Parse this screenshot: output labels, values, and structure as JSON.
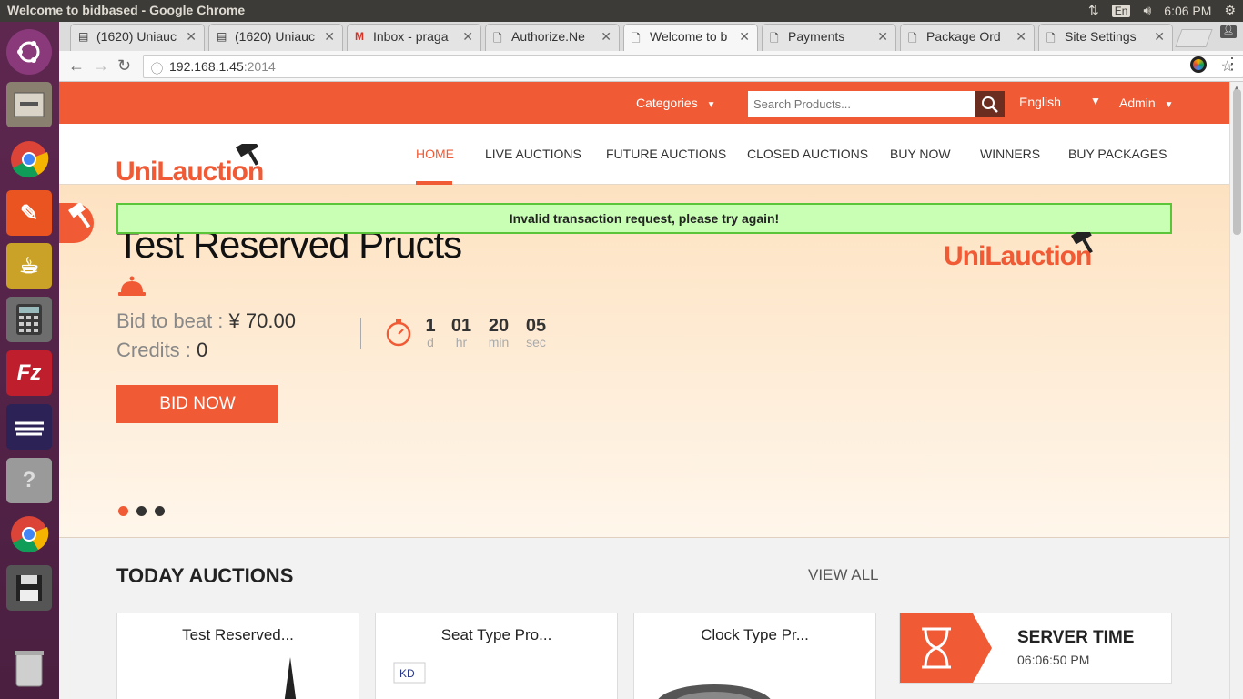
{
  "os": {
    "window_title": "Welcome to bidbased - Google Chrome",
    "keyboard": "En",
    "clock": "6:06 PM"
  },
  "launcher": {
    "apps": [
      "ubuntu-logo-icon",
      "files-icon",
      "chrome-icon",
      "pencil-icon",
      "teapot-icon",
      "calculator-icon",
      "filezilla-icon",
      "eclipse-icon",
      "help-icon",
      "chrome-icon",
      "save-icon",
      "trash-icon"
    ]
  },
  "browser": {
    "tabs": [
      {
        "label": "(1620) Uniauc",
        "icon": "page-icon"
      },
      {
        "label": "(1620) Uniauc",
        "icon": "page-icon"
      },
      {
        "label": "Inbox - praga",
        "icon": "gmail-icon"
      },
      {
        "label": "Authorize.Ne",
        "icon": "page-icon"
      },
      {
        "label": "Welcome to b",
        "icon": "page-icon",
        "active": true
      },
      {
        "label": "Payments",
        "icon": "page-icon"
      },
      {
        "label": "Package Ord",
        "icon": "page-icon"
      },
      {
        "label": "Site Settings",
        "icon": "page-icon"
      }
    ],
    "url_host": "192.168.1.45",
    "url_port": ":2014"
  },
  "header": {
    "categories": "Categories",
    "search_placeholder": "Search Products...",
    "language": "English",
    "user": "Admin"
  },
  "logo": {
    "text": "UniLauction"
  },
  "nav": {
    "items": [
      "HOME",
      "LIVE AUCTIONS",
      "FUTURE AUCTIONS",
      "CLOSED AUCTIONS",
      "BUY NOW",
      "WINNERS",
      "BUY PACKAGES"
    ]
  },
  "hero": {
    "alert": "Invalid transaction request, please try again!",
    "title": "Test Reserved Pructs",
    "bid_label": "Bid to beat :",
    "bid_value": "¥ 70.00",
    "credits_label": "Credits :",
    "credits_value": "0",
    "countdown": [
      {
        "value": "1",
        "unit": "d"
      },
      {
        "value": "01",
        "unit": "hr"
      },
      {
        "value": "20",
        "unit": "min"
      },
      {
        "value": "05",
        "unit": "sec"
      }
    ],
    "bid_button": "BID NOW",
    "slides": 3,
    "active_slide": 1
  },
  "today": {
    "heading": "TODAY AUCTIONS",
    "view_all": "VIEW ALL",
    "cards": [
      "Test Reserved...",
      "Seat Type Pro...",
      "Clock Type Pr..."
    ]
  },
  "server_time": {
    "title": "SERVER TIME",
    "value": "06:06:50 PM"
  },
  "colors": {
    "brand": "#f05a35",
    "alert_bg": "#c9ffb5"
  }
}
